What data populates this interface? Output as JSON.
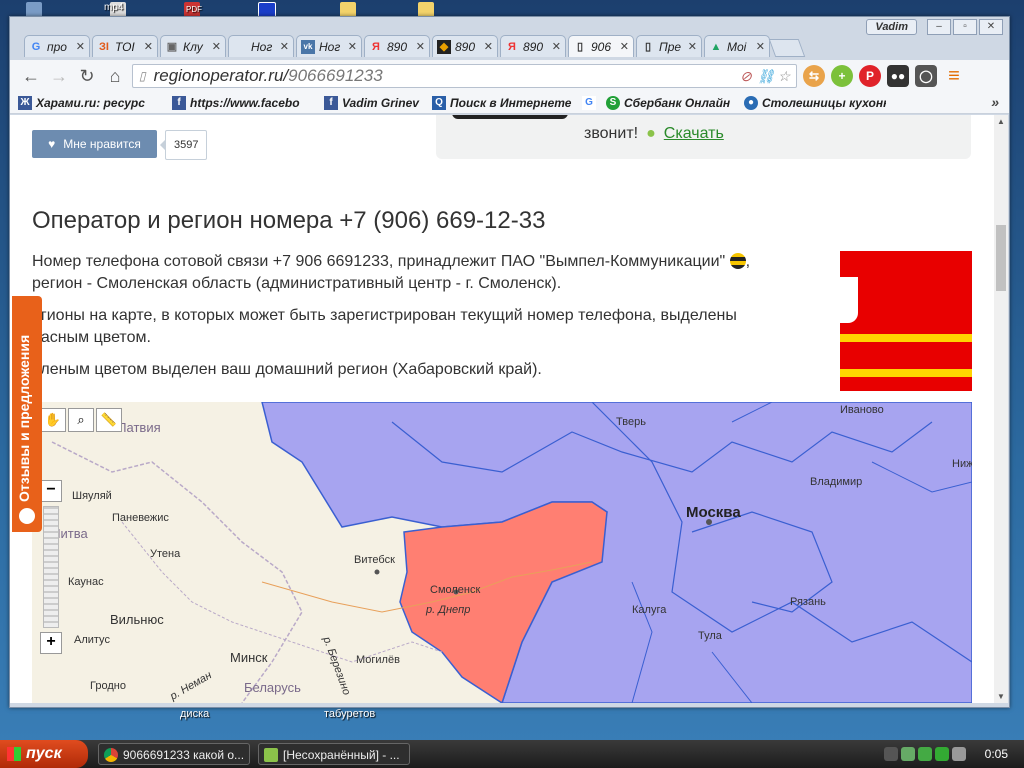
{
  "desktop": {
    "icon_labels": [
      "mp4",
      "PDF",
      "диска",
      "табуретов"
    ]
  },
  "window": {
    "user": "Vadim",
    "controls": {
      "minimize": "–",
      "maximize": "▫",
      "close": "✕"
    }
  },
  "tabs": [
    {
      "label": "про",
      "icon": "G",
      "color": "#4285f4"
    },
    {
      "label": "ТОІ",
      "icon": "ЗІ",
      "color": "#e05a1a"
    },
    {
      "label": "Клу",
      "icon": "▣",
      "color": "#666"
    },
    {
      "label": "Ног",
      "icon": "",
      "color": "#aaa"
    },
    {
      "label": "Ног",
      "icon": "vk",
      "color": "#4a76a8"
    },
    {
      "label": "890",
      "icon": "Я",
      "color": "#e33"
    },
    {
      "label": "890",
      "icon": "◆",
      "color": "#222"
    },
    {
      "label": "890",
      "icon": "Я",
      "color": "#e33"
    },
    {
      "label": "906",
      "icon": "▯",
      "color": "#333",
      "active": true
    },
    {
      "label": "Пре",
      "icon": "▯",
      "color": "#333"
    },
    {
      "label": "Моі",
      "icon": "▲",
      "color": "#1fa463"
    }
  ],
  "toolbar": {
    "back": "←",
    "forward": "→",
    "reload": "↻",
    "home": "⌂",
    "url_domain": "regionoperator.ru/",
    "url_path": "9066691233",
    "menu": "≡"
  },
  "bookmarks": [
    {
      "label": "Харами.ru: ресурс",
      "icon": "Ж",
      "color": "#3b5998"
    },
    {
      "label": "https://www.facebo",
      "icon": "f",
      "color": "#3b5998"
    },
    {
      "label": "Vadim Grinev",
      "icon": "f",
      "color": "#3b5998"
    },
    {
      "label": "Поиск в Интернете",
      "icon": "Q",
      "color": "#2a5fa8"
    },
    {
      "label": "",
      "icon": "G",
      "color": "#4285f4"
    },
    {
      "label": "Сбербанк Онлайн",
      "icon": "S",
      "color": "#21a038"
    },
    {
      "label": "Столешницы кухонн",
      "icon": "●",
      "color": "#2a6cb4"
    }
  ],
  "bookmarks_more": "»",
  "page": {
    "like_label": "Мне нравится",
    "like_count": "3597",
    "promo_text": "звонит!",
    "promo_link": "Скачать",
    "heading": "Оператор и регион номера +7 (906) 669-12-33",
    "para1_a": "Номер телефона сотовой связи +7 906 6691233, принадлежит ПАО \"Вымпел-Коммуникации\"",
    "para1_b": "регион - Смоленская область (административный центр - г. Смоленск).",
    "para2_a": "егионы на карте, в которых может быть зарегистрирован текущий номер телефона, выделены",
    "para2_b": "расным цветом.",
    "para3": "еленым цветом выделен ваш домашний регион (Хабаровский край).",
    "feedback": "Отзывы и предложения"
  },
  "map": {
    "labels": [
      "Тверь",
      "Иваново",
      "Ниж",
      "Владимир",
      "Москва",
      "Смоленск",
      "р. Днепр",
      "Калуга",
      "Тула",
      "Рязань",
      "Витебск",
      "Могилёв",
      "Минск",
      "Беларусь",
      "Вильнюс",
      "Литва",
      "Каунас",
      "Паневежис",
      "Утена",
      "Алитус",
      "Гродно",
      "р. Неман",
      "р. Березино",
      "Латвия",
      "Шяуляй"
    ],
    "region_colors": {
      "highlight": "#ff7f72",
      "covered": "#a7a4f0",
      "border": "#3a5fd1"
    }
  },
  "taskbar": {
    "start": "пуск",
    "tasks": [
      "9066691233 какой о...",
      "[Несохранённый] - ..."
    ],
    "clock": "0:05"
  }
}
